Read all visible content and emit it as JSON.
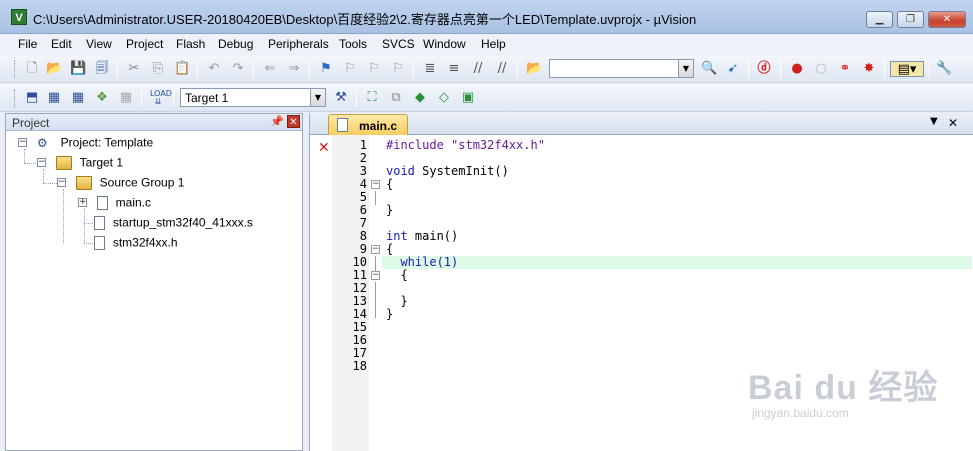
{
  "window": {
    "title": "C:\\Users\\Administrator.USER-20180420EB\\Desktop\\百度经验2\\2.寄存器点亮第一个LED\\Template.uvprojx - µVision",
    "app_icon_letter": "V"
  },
  "menu": [
    "File",
    "Edit",
    "View",
    "Project",
    "Flash",
    "Debug",
    "Peripherals",
    "Tools",
    "SVCS",
    "Window",
    "Help"
  ],
  "toolbar": {
    "find_combo_value": "",
    "target_combo_value": "Target 1"
  },
  "project_panel": {
    "title": "Project",
    "root": "Project: Template",
    "target": "Target 1",
    "group": "Source Group 1",
    "files": [
      "main.c",
      "startup_stm32f40_41xxx.s",
      "stm32f4xx.h"
    ]
  },
  "editor": {
    "tab_label": "main.c",
    "lines": [
      {
        "n": "1",
        "code": "#include \"stm32f4xx.h\""
      },
      {
        "n": "2",
        "code": ""
      },
      {
        "n": "3",
        "code": "void SystemInit()"
      },
      {
        "n": "4",
        "code": "{"
      },
      {
        "n": "5",
        "code": ""
      },
      {
        "n": "6",
        "code": "}"
      },
      {
        "n": "7",
        "code": ""
      },
      {
        "n": "8",
        "code": "int main()"
      },
      {
        "n": "9",
        "code": "{"
      },
      {
        "n": "10",
        "code": "  while(1)"
      },
      {
        "n": "11",
        "code": "  {"
      },
      {
        "n": "12",
        "code": ""
      },
      {
        "n": "13",
        "code": "  }"
      },
      {
        "n": "14",
        "code": "}"
      },
      {
        "n": "15",
        "code": ""
      },
      {
        "n": "16",
        "code": ""
      },
      {
        "n": "17",
        "code": ""
      },
      {
        "n": "18",
        "code": ""
      }
    ]
  },
  "watermark": {
    "brand": "Bai du 经验",
    "url": "jingyan.baidu.com"
  },
  "colors": {
    "keyword": "#1a1ab3",
    "preprocessor": "#6a1b9a",
    "current_line": "#dcfbe6",
    "error_marker": "#d31e1e"
  }
}
